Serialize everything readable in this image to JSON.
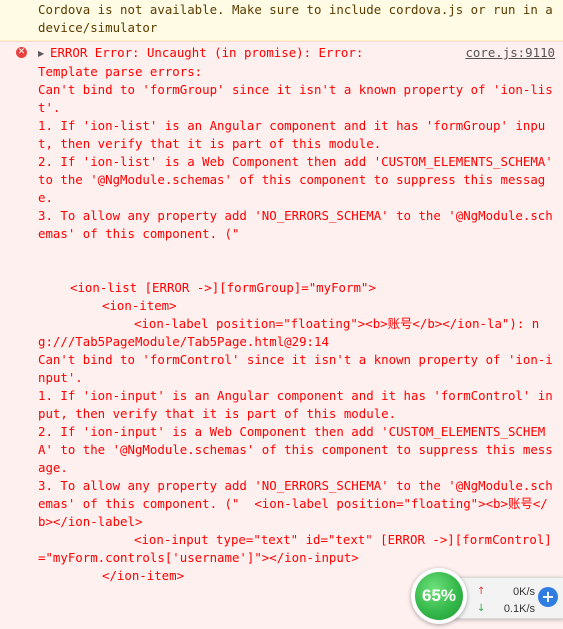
{
  "warning": {
    "text": "Cordova is not available. Make sure to include cordova.js or run in a device/simulator"
  },
  "error": {
    "icon": "error-circle-icon",
    "expander": "▶",
    "headline": "ERROR Error: Uncaught (in promise): Error:",
    "source": "core.js:9110",
    "lines": [
      "Template parse errors:",
      "Can't bind to 'formGroup' since it isn't a known property of 'ion-list'.",
      "1. If 'ion-list' is an Angular component and it has 'formGroup' input, then verify that it is part of this module.",
      "2. If 'ion-list' is a Web Component then add 'CUSTOM_ELEMENTS_SCHEMA' to the '@NgModule.schemas' of this component to suppress this message.",
      "3. To allow any property add 'NO_ERRORS_SCHEMA' to the '@NgModule.schemas' of this component. (\""
    ],
    "template_lines": [
      "<ion-list [ERROR ->][formGroup]=\"myForm\">",
      "<ion-item>",
      "<ion-label position=\"floating\"><b>账号</b></ion-la\"): ng:///Tab5PageModule/Tab5Page.html@29:14"
    ],
    "lines2": [
      "Can't bind to 'formControl' since it isn't a known property of 'ion-input'.",
      "1. If 'ion-input' is an Angular component and it has 'formControl' input, then verify that it is part of this module.",
      "2. If 'ion-input' is a Web Component then add 'CUSTOM_ELEMENTS_SCHEMA' to the '@NgModule.schemas' of this component to suppress this message.",
      "3. To allow any property add 'NO_ERRORS_SCHEMA' to the '@NgModule.schemas' of this component. (\"  <ion-label position=\"floating\"><b>账号</b></ion-label>"
    ],
    "template_lines2": [
      "<ion-input type=\"text\" id=\"text\" [ERROR ->][formControl]=\"myForm.controls['username']\"></ion-input>",
      "</ion-item>"
    ]
  },
  "widget": {
    "percent": "65%",
    "percent_value": 65,
    "upload_speed": "0K/s",
    "download_speed": "0.1K/s",
    "up_arrow": "↑",
    "down_arrow": "↓",
    "plus": "+",
    "colors": {
      "gauge": "#35b84a",
      "plus": "#2f7de1",
      "error_text": "#ff0000",
      "warning_text": "#5c3c00"
    }
  }
}
